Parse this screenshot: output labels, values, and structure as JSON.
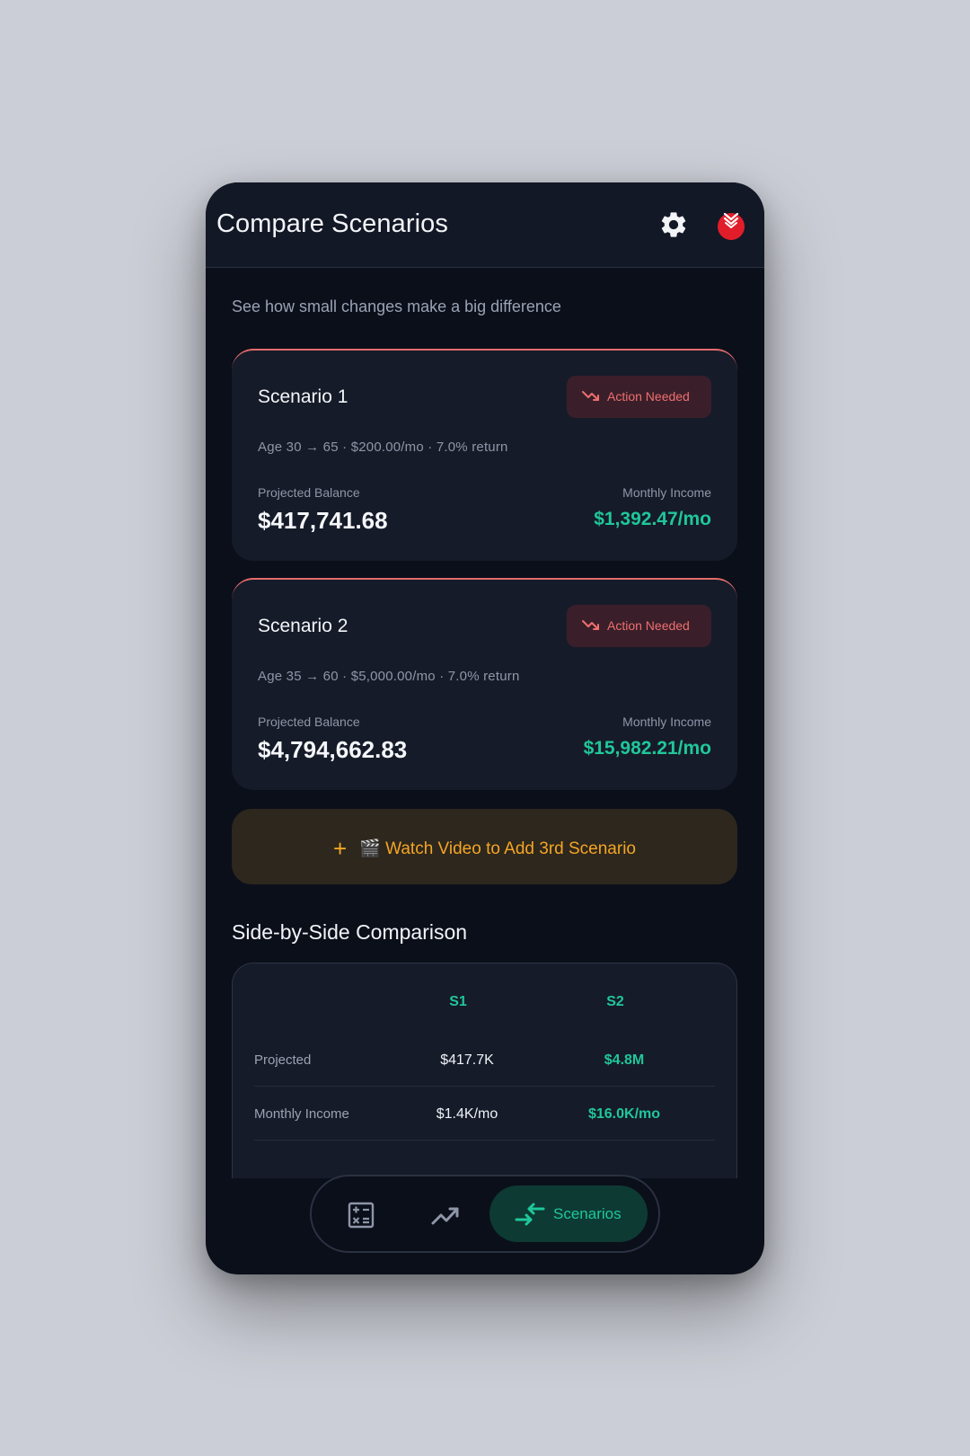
{
  "header": {
    "title": "Compare Scenarios",
    "settings_icon": "gear-icon",
    "profile_icon": "avatar-badge-icon"
  },
  "subtitle": "See how small changes make a big difference",
  "scenarios": [
    {
      "title": "Scenario 1",
      "badge": "Action Needed",
      "meta": "Age 30 → 65 · $200.00/mo · 7.0% return",
      "projected_label": "Projected Balance",
      "projected_value": "$417,741.68",
      "income_label": "Monthly Income",
      "income_value": "$1,392.47/mo"
    },
    {
      "title": "Scenario 2",
      "badge": "Action Needed",
      "meta": "Age 35 → 60 · $5,000.00/mo · 7.0% return",
      "projected_label": "Projected Balance",
      "projected_value": "$4,794,662.83",
      "income_label": "Monthly Income",
      "income_value": "$15,982.21/mo"
    }
  ],
  "add_scenario": {
    "plus": "+",
    "label": "🎬 Watch Video to Add 3rd Scenario"
  },
  "comparison": {
    "title": "Side-by-Side Comparison",
    "columns": [
      "S1",
      "S2"
    ],
    "rows": [
      {
        "label": "Projected",
        "s1": "$417.7K",
        "s2": "$4.8M"
      },
      {
        "label": "Monthly Income",
        "s1": "$1.4K/mo",
        "s2": "$16.0K/mo"
      }
    ]
  },
  "nav": {
    "items": [
      "calculator-icon",
      "trending-up-icon"
    ],
    "active_label": "Scenarios",
    "active_icon": "swap-arrows-icon"
  },
  "colors": {
    "background": "#0b0f1a",
    "card": "#161b29",
    "accent_green": "#1fc79a",
    "warning_red": "#ef6f6f",
    "promo_orange": "#f5a524"
  }
}
